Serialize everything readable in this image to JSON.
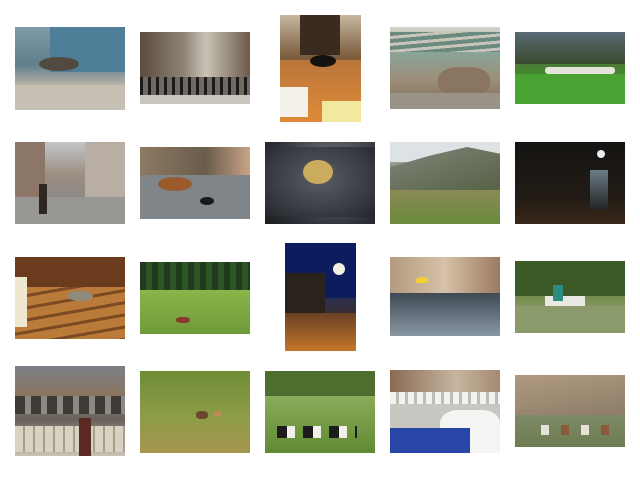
{
  "thumbnails": [
    {
      "id": "cat-on-doorstep",
      "bg": "linear-gradient(180deg,#7f9ba8 0%,#5f7e8c 45%,#b8b2a6 70%,#a7a39a 100%)"
    },
    {
      "id": "city-street-crowd",
      "bg": "linear-gradient(180deg,#d9d5cc 0%,#8f877c 40%,#4a4038 70%,#bdb6ab 100%)"
    },
    {
      "id": "cat-on-kitchen-floor",
      "bg": "linear-gradient(180deg,#c7b7a0 0%,#7a5a3a 40%,#c8823f 75%,#e9d9a8 100%)"
    },
    {
      "id": "cat-under-bench",
      "bg": "linear-gradient(180deg,#d8d4ca 0%,#8aa59a 30%,#9c8d78 65%,#7a6d5d 100%)"
    },
    {
      "id": "sheep-on-meadow",
      "bg": "linear-gradient(180deg,#3d4d55 0%,#55703c 35%,#3f8a2c 60%,#4f9a34 100%)"
    },
    {
      "id": "person-walking-street",
      "bg": "linear-gradient(180deg,#c2c6c8 0%,#9a8e80 40%,#8c8a88 70%,#b5b3ae 100%)"
    },
    {
      "id": "dog-on-pavement",
      "bg": "linear-gradient(180deg,#b0a390 0%,#8a8578 40%,#7d8286 70%,#9aa0a4 100%)"
    },
    {
      "id": "cat-on-pillow",
      "bg": "radial-gradient(circle at 60% 35%,#c9b06a 0%,#5e6064 25%,#2c3036 70%,#1a1c20 100%)"
    },
    {
      "id": "green-hillside",
      "bg": "linear-gradient(180deg,#d6dcde 0%,#8b8f86 30%,#5c6a48 60%,#9a8e58 100%)"
    },
    {
      "id": "night-street-lights",
      "bg": "radial-gradient(circle at 80% 15%,#c6d0d8 0%,#3c3a34 12%,#1b1a18 50%,#2a1e14 100%)"
    },
    {
      "id": "cat-on-wooden-stairs",
      "bg": "linear-gradient(160deg,#5b3318 0%,#8c5a2c 35%,#a46c34 65%,#7c4c22 100%)"
    },
    {
      "id": "animals-in-forest-glade",
      "bg": "linear-gradient(180deg,#2f4a2a 0%,#3d6b2c 40%,#74a048 70%,#89ad52 100%)"
    },
    {
      "id": "night-street-moon",
      "bg": "linear-gradient(180deg,#0b1a58 0%,#1f2f6e 35%,#3a2e28 70%,#a3672a 100%)"
    },
    {
      "id": "flooded-square",
      "bg": "linear-gradient(180deg,#a89078 0%,#c1a890 35%,#4a5560 65%,#7a8a96 100%)"
    },
    {
      "id": "people-on-park-bench",
      "bg": "linear-gradient(180deg,#3e5a2c 0%,#6e8a48 45%,#8c9a6a 70%,#5b6b3f 100%)"
    },
    {
      "id": "sheep-on-road",
      "bg": "linear-gradient(180deg,#7a7f88 0%,#8e7f6a 30%,#6a625c 60%,#c9c3b6 100%)"
    },
    {
      "id": "grazing-field",
      "bg": "linear-gradient(180deg,#6e8a38 0%,#7d9440 40%,#9c9a48 70%,#8a8040 100%)"
    },
    {
      "id": "cows-on-hillside",
      "bg": "linear-gradient(180deg,#6a8c3a 0%,#84a85a 40%,#5f8a30 70%,#3f6a22 100%)"
    },
    {
      "id": "cafe-table-blue",
      "bg": "linear-gradient(180deg,#a8886a 0%,#d6cdbd 35%,#bdbdb7 60%,#2a4aa8 100%)"
    },
    {
      "id": "horses-in-valley",
      "bg": "linear-gradient(180deg,#a5937a 0%,#b5a690 35%,#7a8266 65%,#7a8a5a 100%)"
    }
  ]
}
